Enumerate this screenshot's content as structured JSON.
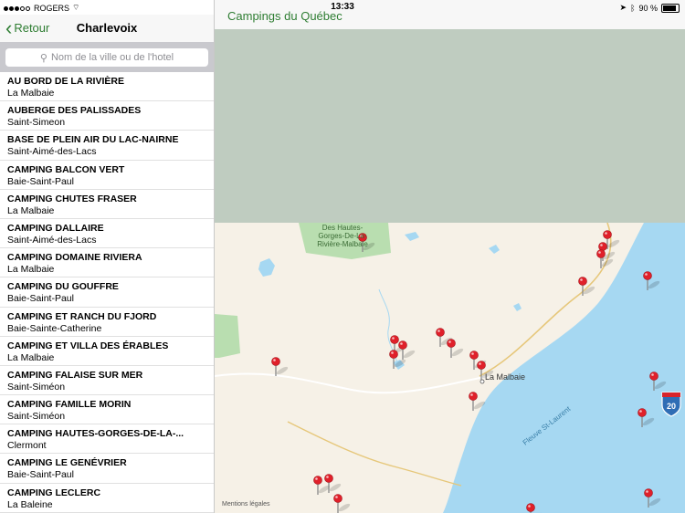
{
  "status": {
    "carrier": "ROGERS",
    "time": "13:33",
    "battery": "90 %",
    "battery_level": 0.9
  },
  "sidebar": {
    "back_label": "Retour",
    "title": "Charlevoix",
    "search_placeholder": "Nom de la ville ou de l'hotel",
    "items": [
      {
        "name": "AU BORD DE LA RIVIÈRE",
        "city": "La Malbaie"
      },
      {
        "name": "AUBERGE DES PALISSADES",
        "city": "Saint-Simeon"
      },
      {
        "name": "BASE DE PLEIN AIR DU LAC-NAIRNE",
        "city": "Saint-Aimé-des-Lacs"
      },
      {
        "name": "CAMPING BALCON VERT",
        "city": "Baie-Saint-Paul"
      },
      {
        "name": "CAMPING CHUTES FRASER",
        "city": "La Malbaie"
      },
      {
        "name": "CAMPING DALLAIRE",
        "city": "Saint-Aimé-des-Lacs"
      },
      {
        "name": "CAMPING DOMAINE RIVIERA",
        "city": "La Malbaie"
      },
      {
        "name": "CAMPING DU GOUFFRE",
        "city": "Baie-Saint-Paul"
      },
      {
        "name": "CAMPING ET RANCH DU FJORD",
        "city": "Baie-Sainte-Catherine"
      },
      {
        "name": "CAMPING ET VILLA DES ÉRABLES",
        "city": "La Malbaie"
      },
      {
        "name": "CAMPING FALAISE SUR MER",
        "city": "Saint-Siméon"
      },
      {
        "name": "CAMPING FAMILLE MORIN",
        "city": "Saint-Siméon"
      },
      {
        "name": "CAMPING HAUTES-GORGES-DE-LA-...",
        "city": "Clermont"
      },
      {
        "name": "CAMPING LE GENÉVRIER",
        "city": "Baie-Saint-Paul"
      },
      {
        "name": "CAMPING LECLERC",
        "city": "La Baleine"
      }
    ]
  },
  "map": {
    "title": "Campings du Québec",
    "park_label": [
      "Des Hautes-",
      "Gorges-De-La-",
      "Rivière-Malbaie"
    ],
    "town_label": "La Malbaie",
    "river_label": "Fleuve St-Laurent",
    "highway_label": "20",
    "legal_label": "Mentions légales",
    "colors": {
      "land": "#f6f1e7",
      "water": "#a6d8f2",
      "park": "#b9deb0",
      "unloaded": "#bfccc0",
      "pin": "#e0202a"
    }
  }
}
